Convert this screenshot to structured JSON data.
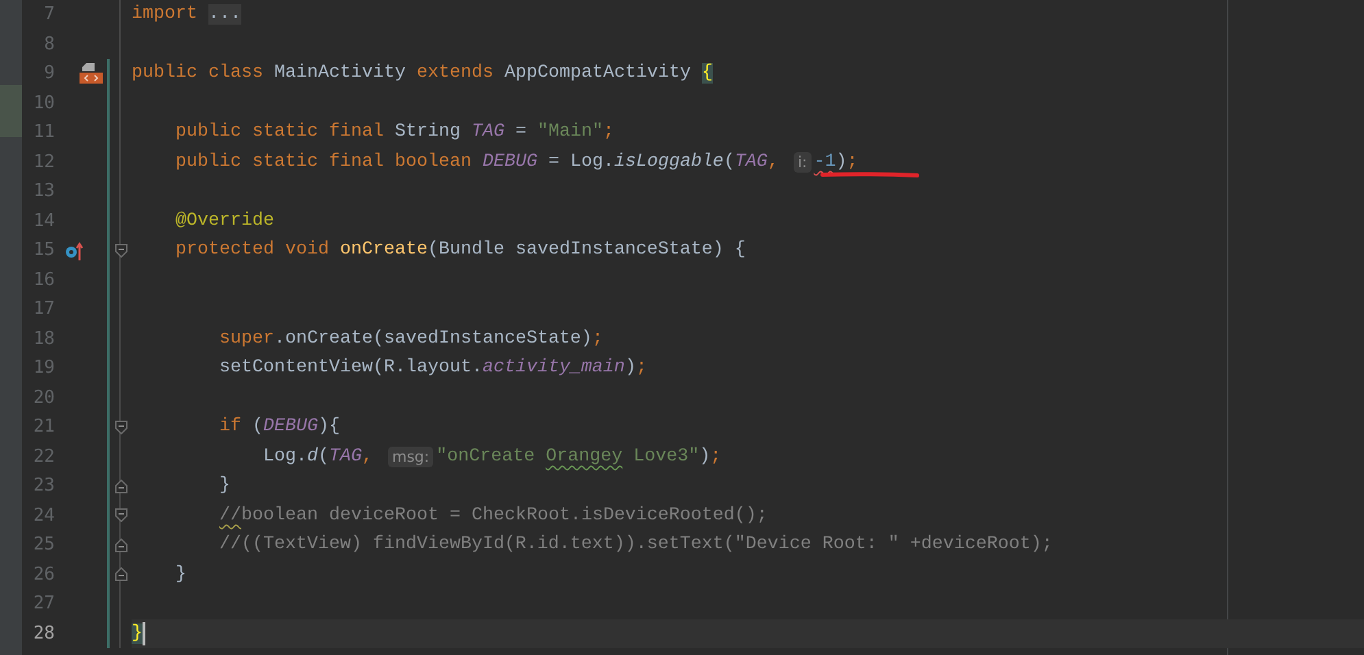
{
  "editor": {
    "lines": [
      {
        "number": "7",
        "current": false,
        "changed": false,
        "tokens": [
          {
            "kind": "keyword",
            "text": "import "
          },
          {
            "kind": "folded",
            "text": "..."
          }
        ]
      },
      {
        "number": "8",
        "current": false,
        "changed": false
      },
      {
        "number": "9",
        "current": false,
        "changed": true,
        "gutter_icon": {
          "kind": "class"
        },
        "tokens": [
          {
            "kind": "keyword",
            "text": "public class "
          },
          {
            "kind": "plain",
            "text": "MainActivity "
          },
          {
            "kind": "keyword",
            "text": "extends "
          },
          {
            "kind": "plain",
            "text": "AppCompatActivity "
          },
          {
            "kind": "brace",
            "text": "{"
          }
        ]
      },
      {
        "number": "10",
        "current": false,
        "changed": true
      },
      {
        "number": "11",
        "current": false,
        "changed": true,
        "tokens": [
          {
            "kind": "keyword",
            "text": "    public static final "
          },
          {
            "kind": "plain",
            "text": "String "
          },
          {
            "kind": "constant",
            "text": "TAG"
          },
          {
            "kind": "plain",
            "text": " = "
          },
          {
            "kind": "string",
            "text": "\"Main\""
          },
          {
            "kind": "keyword",
            "text": ";"
          }
        ]
      },
      {
        "number": "12",
        "current": false,
        "changed": true,
        "underlined": true,
        "tokens": [
          {
            "kind": "keyword",
            "text": "    public static final boolean "
          },
          {
            "kind": "constant",
            "text": "DEBUG"
          },
          {
            "kind": "plain",
            "text": " = Log."
          },
          {
            "kind": "italic",
            "text": "isLoggable"
          },
          {
            "kind": "plain",
            "text": "("
          },
          {
            "kind": "constant",
            "text": "TAG"
          },
          {
            "kind": "keyword",
            "text": ", "
          },
          {
            "kind": "hint",
            "text": "i:"
          },
          {
            "kind": "number",
            "text": "-1",
            "squiggle": {
              "kind": "error"
            }
          },
          {
            "kind": "plain",
            "text": ")"
          },
          {
            "kind": "keyword",
            "text": ";"
          }
        ]
      },
      {
        "number": "13",
        "current": false,
        "changed": true
      },
      {
        "number": "14",
        "current": false,
        "changed": true,
        "tokens": [
          {
            "kind": "annotation",
            "text": "    @Override"
          }
        ]
      },
      {
        "number": "15",
        "current": false,
        "changed": true,
        "gutter_icon": {
          "kind": "override"
        },
        "fold": {
          "kind": "start"
        },
        "tokens": [
          {
            "kind": "keyword",
            "text": "    protected void "
          },
          {
            "kind": "method",
            "text": "onCreate"
          },
          {
            "kind": "plain",
            "text": "(Bundle savedInstanceState) {"
          }
        ]
      },
      {
        "number": "16",
        "current": false,
        "changed": true
      },
      {
        "number": "17",
        "current": false,
        "changed": true
      },
      {
        "number": "18",
        "current": false,
        "changed": true,
        "tokens": [
          {
            "kind": "keyword",
            "text": "        super"
          },
          {
            "kind": "plain",
            "text": ".onCreate(savedInstanceState)"
          },
          {
            "kind": "keyword",
            "text": ";"
          }
        ]
      },
      {
        "number": "19",
        "current": false,
        "changed": true,
        "tokens": [
          {
            "kind": "plain",
            "text": "        setContentView(R.layout."
          },
          {
            "kind": "constant",
            "text": "activity_main"
          },
          {
            "kind": "plain",
            "text": ")"
          },
          {
            "kind": "keyword",
            "text": ";"
          }
        ]
      },
      {
        "number": "20",
        "current": false,
        "changed": true
      },
      {
        "number": "21",
        "current": false,
        "changed": true,
        "fold": {
          "kind": "start"
        },
        "tokens": [
          {
            "kind": "keyword",
            "text": "        if "
          },
          {
            "kind": "plain",
            "text": "("
          },
          {
            "kind": "constant",
            "text": "DEBUG"
          },
          {
            "kind": "plain",
            "text": "){"
          }
        ]
      },
      {
        "number": "22",
        "current": false,
        "changed": true,
        "tokens": [
          {
            "kind": "plain",
            "text": "            Log."
          },
          {
            "kind": "italic",
            "text": "d"
          },
          {
            "kind": "plain",
            "text": "("
          },
          {
            "kind": "constant",
            "text": "TAG"
          },
          {
            "kind": "keyword",
            "text": ", "
          },
          {
            "kind": "hint",
            "text": "msg:"
          },
          {
            "kind": "string",
            "text": "\"onCreate "
          },
          {
            "kind": "string",
            "text": "Orangey",
            "squiggle": {
              "kind": "typo"
            }
          },
          {
            "kind": "string",
            "text": " Love3\""
          },
          {
            "kind": "plain",
            "text": ")"
          },
          {
            "kind": "keyword",
            "text": ";"
          }
        ]
      },
      {
        "number": "23",
        "current": false,
        "changed": true,
        "fold": {
          "kind": "end"
        },
        "tokens": [
          {
            "kind": "plain",
            "text": "        }"
          }
        ]
      },
      {
        "number": "24",
        "current": false,
        "changed": true,
        "fold": {
          "kind": "start"
        },
        "tokens": [
          {
            "kind": "comment",
            "text": "        //",
            "squiggle": {
              "kind": "warning"
            }
          },
          {
            "kind": "comment",
            "text": "boolean deviceRoot = CheckRoot.isDeviceRooted();"
          }
        ]
      },
      {
        "number": "25",
        "current": false,
        "changed": true,
        "fold": {
          "kind": "end"
        },
        "tokens": [
          {
            "kind": "comment",
            "text": "        //((TextView) findViewById(R.id.text)).setText(\"Device Root: \" +deviceRoot);"
          }
        ]
      },
      {
        "number": "26",
        "current": false,
        "changed": true,
        "fold": {
          "kind": "end"
        },
        "tokens": [
          {
            "kind": "plain",
            "text": "    }"
          }
        ]
      },
      {
        "number": "27",
        "current": false,
        "changed": true
      },
      {
        "number": "28",
        "current": true,
        "changed": true,
        "tokens": [
          {
            "kind": "brace",
            "text": "}"
          }
        ]
      }
    ]
  }
}
